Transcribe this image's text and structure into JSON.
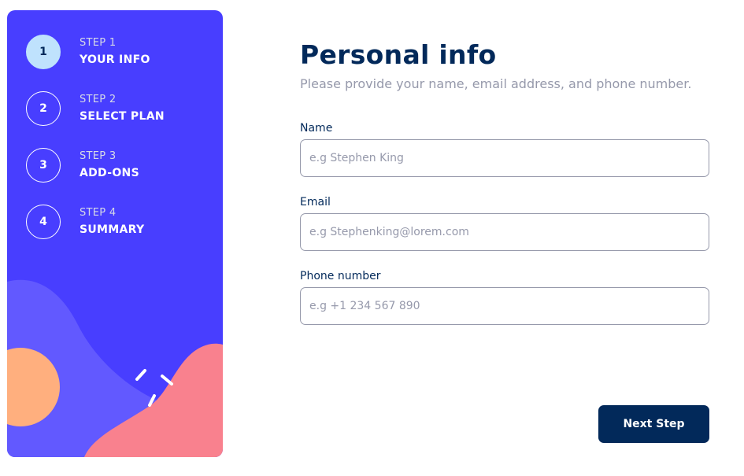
{
  "sidebar": {
    "steps": [
      {
        "number": "1",
        "label": "STEP 1",
        "title": "YOUR INFO",
        "active": true
      },
      {
        "number": "2",
        "label": "STEP 2",
        "title": "SELECT PLAN",
        "active": false
      },
      {
        "number": "3",
        "label": "STEP 3",
        "title": "ADD-ONS",
        "active": false
      },
      {
        "number": "4",
        "label": "STEP 4",
        "title": "SUMMARY",
        "active": false
      }
    ]
  },
  "main": {
    "title": "Personal info",
    "subtitle": "Please provide your name, email address, and phone number.",
    "fields": {
      "name": {
        "label": "Name",
        "placeholder": "e.g Stephen King",
        "value": ""
      },
      "email": {
        "label": "Email",
        "placeholder": "e.g Stephenking@lorem.com",
        "value": ""
      },
      "phone": {
        "label": "Phone number",
        "placeholder": "e.g +1 234 567 890",
        "value": ""
      }
    },
    "next_label": "Next Step"
  },
  "colors": {
    "sidebar_bg": "#483eff",
    "active_step_bg": "#bfe2fd",
    "primary_dark": "#02295a",
    "text_muted": "#9699ab",
    "blob_purple": "#6259ff",
    "blob_orange": "#ffaf7e",
    "blob_pink": "#f9818e"
  }
}
